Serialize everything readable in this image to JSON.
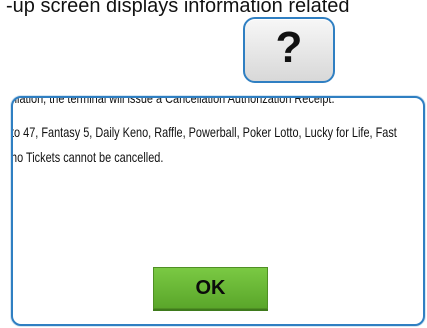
{
  "header_text": "-up screen displays information related",
  "help_badge": {
    "symbol": "?"
  },
  "dialog": {
    "lines": [
      "ncellation, the terminal will issue a Cancellation Authorization Receipt.",
      "to 47, Fantasy 5, Daily Keno, Raffle, Powerball, Poker Lotto, Lucky for Life, Fast",
      "no Tickets cannot be cancelled."
    ],
    "ok_label": "OK"
  },
  "colors": {
    "accent": "#2f7fc2",
    "ok_button": "#6bb536"
  }
}
